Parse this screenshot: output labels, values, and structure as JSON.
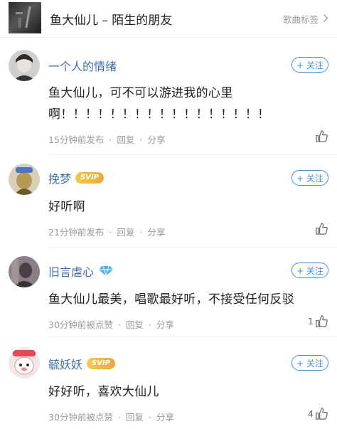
{
  "header": {
    "title": "鱼大仙儿 – 陌生的朋友",
    "tag_label": "歌曲标签",
    "tag_icon": "chevron-right-icon"
  },
  "accent_color": "#3f8fe0",
  "name_color": "#3f6ea6",
  "comments": [
    {
      "username": "一个人的情绪",
      "badge": "",
      "follow_label": "+ 关注",
      "text_line1": "鱼大仙儿，可不可以游进我的心里",
      "text_line2": "啊！！！！！！！！！！！！！！！！！",
      "time": "15分钟前发布",
      "reply": "回复",
      "share": "分享",
      "like_count": ""
    },
    {
      "username": "挽梦",
      "badge": "SVIP",
      "follow_label": "+ 关注",
      "text_line1": "好听啊",
      "time": "21分钟前发布",
      "reply": "回复",
      "share": "分享",
      "like_count": ""
    },
    {
      "username": "旧言虐心",
      "badge": "diamond-badge-icon",
      "follow_label": "+ 关注",
      "text_line1": "鱼大仙儿最美，唱歌最好听，不接受任何反驳",
      "time": "30分钟前被点赞",
      "reply": "回复",
      "share": "分享",
      "like_count": "1"
    },
    {
      "username": "毓妖妖",
      "badge": "SVIP",
      "follow_label": "+ 关注",
      "text_line1": "好好听，喜欢大仙儿",
      "time": "30分钟前被点赞",
      "reply": "回复",
      "share": "分享",
      "like_count": "4"
    }
  ]
}
